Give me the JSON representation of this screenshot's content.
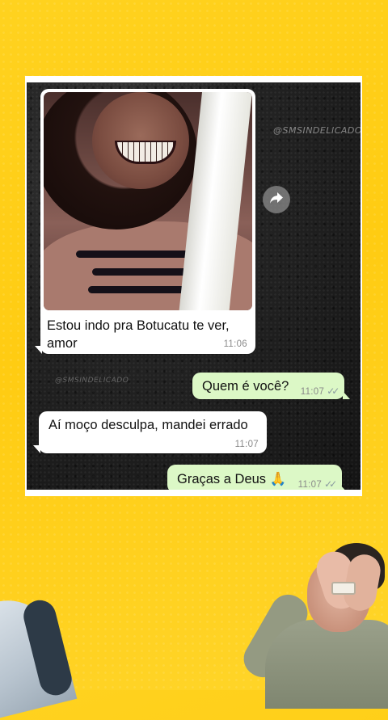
{
  "watermark": "@SMSINDELICADO",
  "messages": [
    {
      "direction": "in",
      "type": "image",
      "caption": "Estou indo pra Botucatu te ver, amor",
      "time": "11:06"
    },
    {
      "direction": "out",
      "text": "Quem é você?",
      "time": "11:07",
      "status": "✓✓"
    },
    {
      "direction": "in",
      "text": "Aí moço desculpa, mandei errado",
      "time": "11:07"
    },
    {
      "direction": "out",
      "text": "Graças a Deus 🙏",
      "time": "11:07",
      "status": "✓✓"
    }
  ],
  "icons": {
    "forward": "forward-icon"
  },
  "colors": {
    "background": "#ffcc12",
    "chat_background": "#1e1e1e",
    "incoming_bubble": "#ffffff",
    "outgoing_bubble": "#dcf8c6",
    "timestamp": "#8a8a8a"
  }
}
